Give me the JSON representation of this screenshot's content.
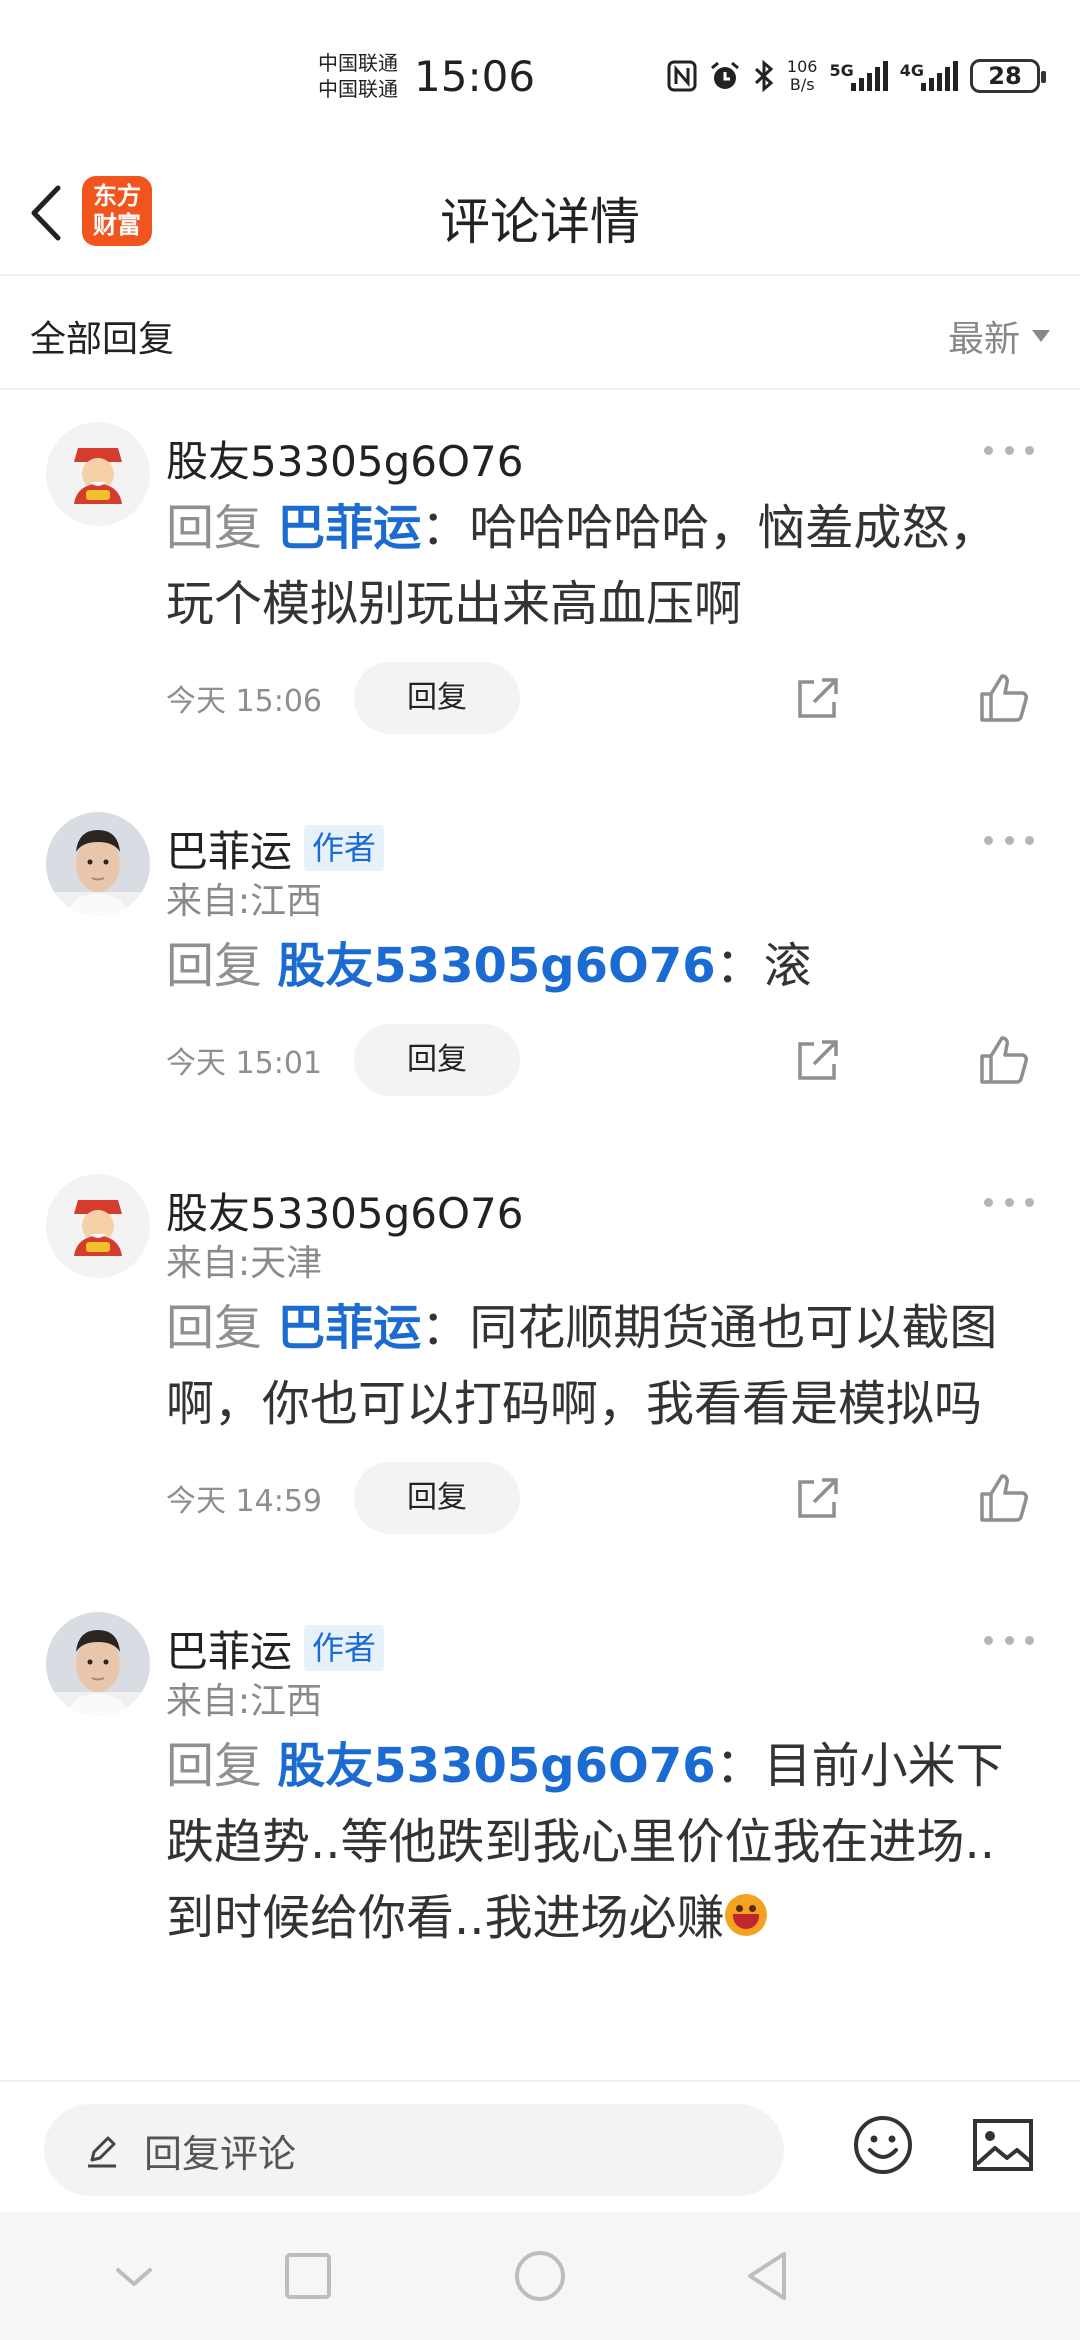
{
  "status_bar": {
    "carrier_1": "中国联通",
    "carrier_2": "中国联通",
    "time": "15:06",
    "net_speed_value": "106",
    "net_speed_unit": "B/s",
    "gen_1": "5G",
    "gen_2": "4G",
    "battery": "28",
    "icons": [
      "nfc-icon",
      "alarm-icon",
      "bluetooth-icon",
      "signal-icon",
      "battery-icon"
    ]
  },
  "header": {
    "back_icon": "chevron-left-icon",
    "logo_line1": "东方",
    "logo_line2": "财富",
    "title": "评论详情"
  },
  "filter": {
    "label": "全部回复",
    "sort": "最新"
  },
  "colors": {
    "accent": "#1b6bd2",
    "logo": "#f1541d",
    "muted": "#8f8f8f"
  },
  "comments": [
    {
      "username": "股友53305g6O76",
      "author_badge": "",
      "origin": "",
      "reply_label": "回复",
      "mention": "巴菲运",
      "separator": "：",
      "text": "哈哈哈哈哈，恼羞成怒，玩个模拟别玩出来高血压啊",
      "time": "今天 15:06",
      "reply_button": "回复"
    },
    {
      "username": "巴菲运",
      "author_badge": "作者",
      "origin": "来自:江西",
      "reply_label": "回复",
      "mention": "股友53305g6O76",
      "separator": "：",
      "text": "滚",
      "time": "今天 15:01",
      "reply_button": "回复"
    },
    {
      "username": "股友53305g6O76",
      "author_badge": "",
      "origin": "来自:天津",
      "reply_label": "回复",
      "mention": "巴菲运",
      "separator": "：",
      "text": "同花顺期货通也可以截图啊，你也可以打码啊，我看看是模拟吗",
      "time": "今天 14:59",
      "reply_button": "回复"
    },
    {
      "username": "巴菲运",
      "author_badge": "作者",
      "origin": "来自:江西",
      "reply_label": "回复",
      "mention": "股友53305g6O76",
      "separator": "：",
      "text": "目前小米下跌趋势..等他跌到我心里价位我在进场..到时候给你看..我进场必赚",
      "time": "",
      "reply_button": ""
    }
  ],
  "input_bar": {
    "placeholder": "回复评论",
    "emoji_icon": "smiley-icon",
    "image_icon": "image-icon"
  },
  "nav_bar": [
    "chevron-down-icon",
    "square-icon",
    "circle-icon",
    "triangle-back-icon"
  ]
}
